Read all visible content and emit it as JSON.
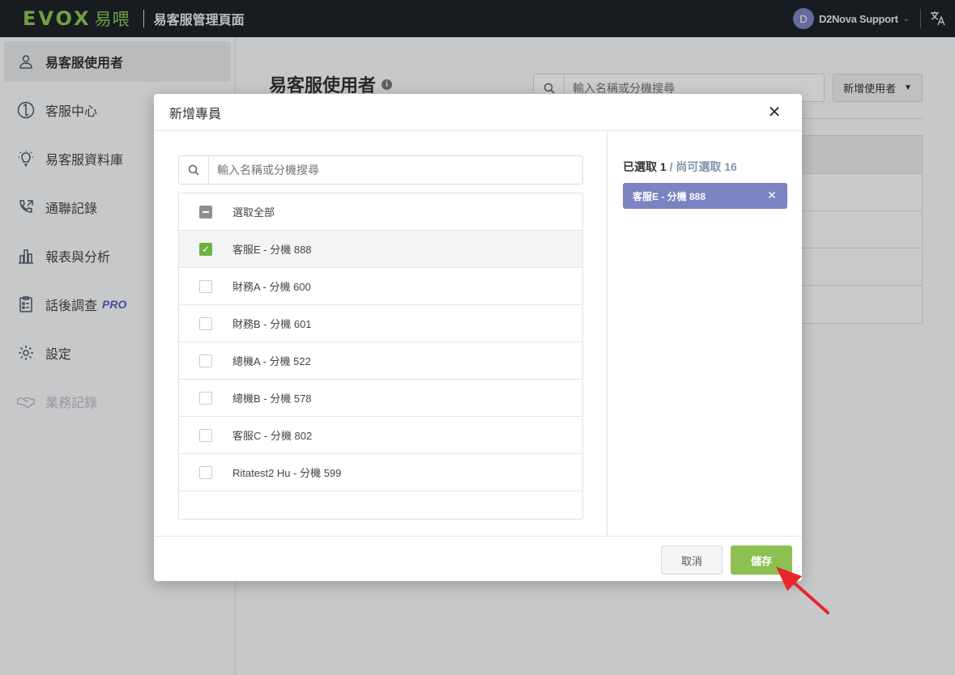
{
  "topbar": {
    "logo_text": "EVOX",
    "logo_cn": "易喂",
    "title": "易客服管理頁面",
    "user_initial": "D",
    "user_name": "D2Nova Support",
    "language_icon": "translate-icon"
  },
  "sidebar": {
    "items": [
      {
        "label": "易客服使用者",
        "icon": "user-icon",
        "active": true
      },
      {
        "label": "客服中心",
        "icon": "phone-transfer-icon"
      },
      {
        "label": "易客服資料庫",
        "icon": "lightbulb-icon"
      },
      {
        "label": "通聯記錄",
        "icon": "call-log-icon"
      },
      {
        "label": "報表與分析",
        "icon": "bar-chart-icon"
      },
      {
        "label": "話後調查",
        "icon": "survey-icon",
        "badge": "PRO"
      },
      {
        "label": "設定",
        "icon": "gear-icon"
      },
      {
        "label": "業務記錄",
        "icon": "handshake-icon",
        "disabled": true
      }
    ]
  },
  "main": {
    "page_title": "易客服使用者",
    "search_placeholder": "輸入名稱或分機搜尋",
    "add_user_label": "新增使用者"
  },
  "modal": {
    "title": "新增專員",
    "search_placeholder": "輸入名稱或分機搜尋",
    "select_all_label": "選取全部",
    "options": [
      {
        "label": "客服E - 分機 888",
        "checked": true
      },
      {
        "label": "財務A - 分機 600",
        "checked": false
      },
      {
        "label": "財務B - 分機 601",
        "checked": false
      },
      {
        "label": "總機A - 分機 522",
        "checked": false
      },
      {
        "label": "總機B - 分機 578",
        "checked": false
      },
      {
        "label": "客服C - 分機 802",
        "checked": false
      },
      {
        "label": "Ritatest2 Hu - 分機 599",
        "checked": false
      }
    ],
    "selected_prefix": "已選取 1",
    "remaining_text": "/ 尚可選取 16",
    "selected_chips": [
      "客服E - 分機 888"
    ],
    "cancel_label": "取消",
    "save_label": "儲存"
  },
  "colors": {
    "brand_green": "#8cc152",
    "chip_purple": "#7b83c3",
    "topbar_dark": "#1d2328",
    "annotation_red": "#e8262b"
  }
}
